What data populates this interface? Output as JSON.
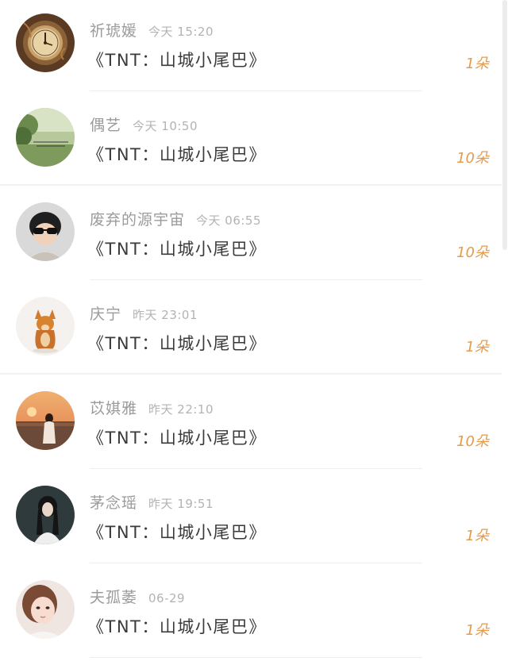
{
  "comments": [
    {
      "name": "祈琥媛",
      "time": "今天 15:20",
      "message": "《TNT：山城小尾巴》",
      "gift": "1朵",
      "avatar": "pocket-watch-avatar"
    },
    {
      "name": "偶艺",
      "time": "今天 10:50",
      "message": "《TNT：山城小尾巴》",
      "gift": "10朵",
      "avatar": "green-landscape-avatar"
    },
    {
      "name": "废弃的源宇宙",
      "time": "今天 06:55",
      "message": "《TNT：山城小尾巴》",
      "gift": "10朵",
      "avatar": "boy-sunglasses-avatar"
    },
    {
      "name": "庆宁",
      "time": "昨天 23:01",
      "message": "《TNT：山城小尾巴》",
      "gift": "1朵",
      "avatar": "shiba-dog-avatar"
    },
    {
      "name": "苡娸雅",
      "time": "昨天 22:10",
      "message": "《TNT：山城小尾巴》",
      "gift": "10朵",
      "avatar": "sunset-girl-avatar"
    },
    {
      "name": "茅念瑶",
      "time": "昨天 19:51",
      "message": "《TNT：山城小尾巴》",
      "gift": "1朵",
      "avatar": "dark-hair-girl-avatar"
    },
    {
      "name": "夫孤萎",
      "time": "06-29",
      "message": "《TNT：山城小尾巴》",
      "gift": "1朵",
      "avatar": "girl-portrait-avatar"
    }
  ],
  "colors": {
    "gift": "#e49b4e",
    "name": "#9b9b9b",
    "time": "#b3b3b3",
    "message": "#3a3a3a",
    "divider": "#eeeeee"
  }
}
